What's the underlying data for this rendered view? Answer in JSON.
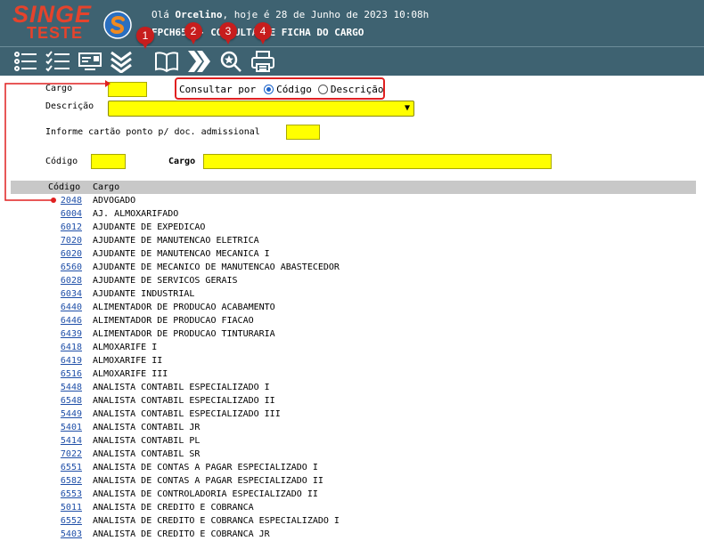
{
  "header": {
    "logo_top": "SINGE",
    "logo_bottom": "TESTE",
    "greeting_prefix": "Olá ",
    "user": "Orcelino",
    "greeting_suffix": ", hoje é 28 de Junho de 2023 10:08h",
    "title": "FPCH652 - CONSULTA DE FICHA DO CARGO"
  },
  "toolbar": {
    "buttons": [
      "list-icon",
      "checklist-icon",
      "card-icon",
      "collapse-icon",
      "book-icon",
      "next-icon",
      "search-star-icon",
      "print-icon"
    ],
    "callouts": [
      "1",
      "2",
      "3",
      "4"
    ]
  },
  "form": {
    "cargo_label": "Cargo",
    "descricao_label": "Descrição",
    "cartao_label": "Informe cartão ponto p/ doc. admissional",
    "codigo_label": "Código",
    "cargo2_label": "Cargo",
    "consultar_label": "Consultar por",
    "option_codigo": "Código",
    "option_descricao": "Descrição",
    "selected_option": "Código"
  },
  "table": {
    "headers": [
      "Código",
      "Cargo"
    ],
    "rows": [
      {
        "codigo": "2048",
        "cargo": "ADVOGADO"
      },
      {
        "codigo": "6004",
        "cargo": "AJ. ALMOXARIFADO"
      },
      {
        "codigo": "6012",
        "cargo": "AJUDANTE DE EXPEDICAO"
      },
      {
        "codigo": "7020",
        "cargo": "AJUDANTE DE MANUTENCAO ELETRICA"
      },
      {
        "codigo": "6020",
        "cargo": "AJUDANTE DE MANUTENCAO MECANICA I"
      },
      {
        "codigo": "6560",
        "cargo": "AJUDANTE DE MECANICO DE MANUTENCAO ABASTECEDOR"
      },
      {
        "codigo": "6028",
        "cargo": "AJUDANTE DE SERVICOS GERAIS"
      },
      {
        "codigo": "6034",
        "cargo": "AJUDANTE INDUSTRIAL"
      },
      {
        "codigo": "6440",
        "cargo": "ALIMENTADOR DE PRODUCAO ACABAMENTO"
      },
      {
        "codigo": "6446",
        "cargo": "ALIMENTADOR DE PRODUCAO FIACAO"
      },
      {
        "codigo": "6439",
        "cargo": "ALIMENTADOR DE PRODUCAO TINTURARIA"
      },
      {
        "codigo": "6418",
        "cargo": "ALMOXARIFE I"
      },
      {
        "codigo": "6419",
        "cargo": "ALMOXARIFE II"
      },
      {
        "codigo": "6516",
        "cargo": "ALMOXARIFE III"
      },
      {
        "codigo": "5448",
        "cargo": "ANALISTA CONTABIL ESPECIALIZADO I"
      },
      {
        "codigo": "6548",
        "cargo": "ANALISTA CONTABIL ESPECIALIZADO II"
      },
      {
        "codigo": "5449",
        "cargo": "ANALISTA CONTABIL ESPECIALIZADO III"
      },
      {
        "codigo": "5401",
        "cargo": "ANALISTA CONTABIL JR"
      },
      {
        "codigo": "5414",
        "cargo": "ANALISTA CONTABIL PL"
      },
      {
        "codigo": "7022",
        "cargo": "ANALISTA CONTABIL SR"
      },
      {
        "codigo": "6551",
        "cargo": "ANALISTA DE CONTAS A PAGAR ESPECIALIZADO I"
      },
      {
        "codigo": "6582",
        "cargo": "ANALISTA DE CONTAS A PAGAR ESPECIALIZADO II"
      },
      {
        "codigo": "6553",
        "cargo": "ANALISTA DE CONTROLADORIA ESPECIALIZADO II"
      },
      {
        "codigo": "5011",
        "cargo": "ANALISTA DE CREDITO E COBRANCA"
      },
      {
        "codigo": "6552",
        "cargo": "ANALISTA DE CREDITO E COBRANCA ESPECIALIZADO I"
      },
      {
        "codigo": "5403",
        "cargo": "ANALISTA DE CREDITO E COBRANCA JR"
      }
    ]
  },
  "colors": {
    "header_bg": "#3e6271",
    "logo": "#e5432c",
    "input_bg": "#ffff00",
    "link": "#1f4fa8",
    "annotation": "#e02020"
  }
}
